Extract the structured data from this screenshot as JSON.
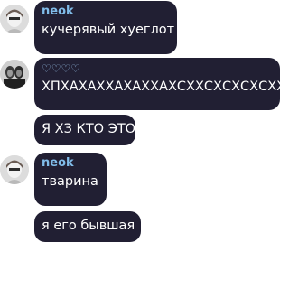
{
  "messages": [
    {
      "sender": "neok",
      "text": "кучерявый хуеглот"
    },
    {
      "sender": "♡♡♡♡",
      "text": "ХПХАХАХХАХАХХАХСХХСХСХСХСХХС"
    },
    {
      "sender": "",
      "text": "Я ХЗ КТО ЭТО"
    },
    {
      "sender": "neok",
      "text": "тварина"
    },
    {
      "sender": "",
      "text": "я его бывшая"
    }
  ],
  "colors": {
    "bubble": "#211f33",
    "sender_name": "#80bce9",
    "hearts": "#93b9e0",
    "text": "#ffffff"
  }
}
